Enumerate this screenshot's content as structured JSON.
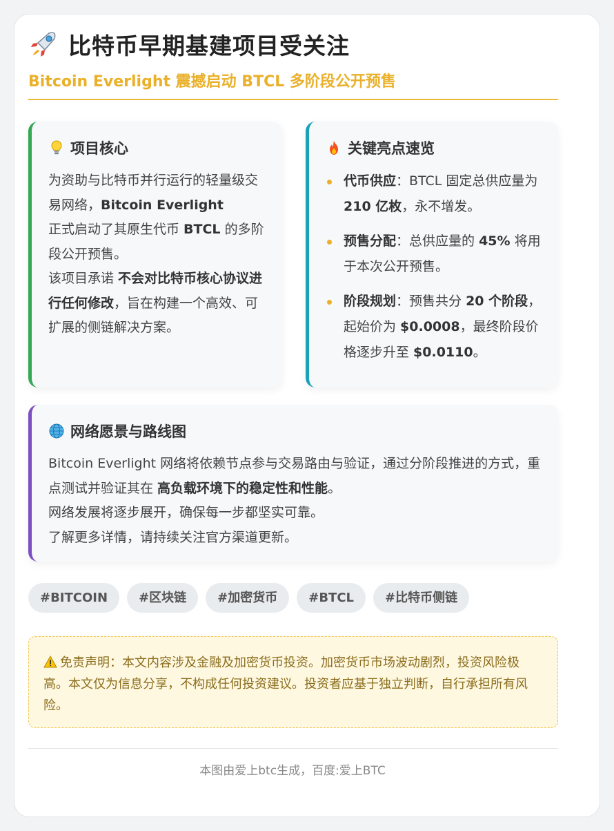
{
  "header": {
    "title": "比特币早期基建项目受关注",
    "subtitle": "Bitcoin Everlight 震撼启动 BTCL 多阶段公开预售"
  },
  "core": {
    "title": "项目核心",
    "icon": "lightbulb-icon",
    "p1_a": "为资助与比特币并行运行的轻量级交易网络，",
    "p1_b": "Bitcoin Everlight",
    "p1_c": "正式启动了其原生代币 ",
    "p1_d": "BTCL",
    "p1_e": " 的多阶段公开预售。",
    "p2_a": "该项目承诺 ",
    "p2_b": "不会对比特币核心协议进行任何修改",
    "p2_c": "，旨在构建一个高效、可扩展的侧链解决方案。"
  },
  "highlights": {
    "title": "关键亮点速览",
    "icon": "fire-icon",
    "items": [
      {
        "label": "代币供应",
        "t1": "：BTCL 固定总供应量为 ",
        "b1": "210 亿枚",
        "t2": "，永不增发。",
        "b2": "",
        "t3": "",
        "b3": "",
        "t4": ""
      },
      {
        "label": "预售分配",
        "t1": "：总供应量的 ",
        "b1": "45%",
        "t2": " 将用于本次公开预售。",
        "b2": "",
        "t3": "",
        "b3": "",
        "t4": ""
      },
      {
        "label": "阶段规划",
        "t1": "：预售共分 ",
        "b1": "20 个阶段",
        "t2": "，起始价为 ",
        "b2": "$0.0008",
        "t3": "，最终阶段价格逐步升至 ",
        "b3": "$0.0110",
        "t4": "。"
      }
    ]
  },
  "vision": {
    "title": "网络愿景与路线图",
    "icon": "globe-icon",
    "p1_a": "Bitcoin Everlight 网络将依赖节点参与交易路由与验证，通过分阶段推进的方式，重点测试并验证其在 ",
    "p1_b": "高负载环境下的稳定性和性能",
    "p1_c": "。",
    "p2": "网络发展将逐步展开，确保每一步都坚实可靠。",
    "p3": "了解更多详情，请持续关注官方渠道更新。"
  },
  "tags": [
    "#BITCOIN",
    "#区块链",
    "#加密货币",
    "#BTCL",
    "#比特币侧链"
  ],
  "disclaimer": {
    "icon": "warning-icon",
    "text": "免责声明：本文内容涉及金融及加密货币投资。加密货币市场波动剧烈，投资风险极高。本文仅为信息分享，不构成任何投资建议。投资者应基于独立判断，自行承担所有风险。"
  },
  "footer": {
    "text": "本图由爱上btc生成，百度:爱上BTC"
  },
  "colors": {
    "accent": "#eab029",
    "core_border": "#34a853",
    "highlights_border": "#17a2b8",
    "vision_border": "#7b4fc2",
    "disclaimer_bg": "#fff8e1"
  }
}
